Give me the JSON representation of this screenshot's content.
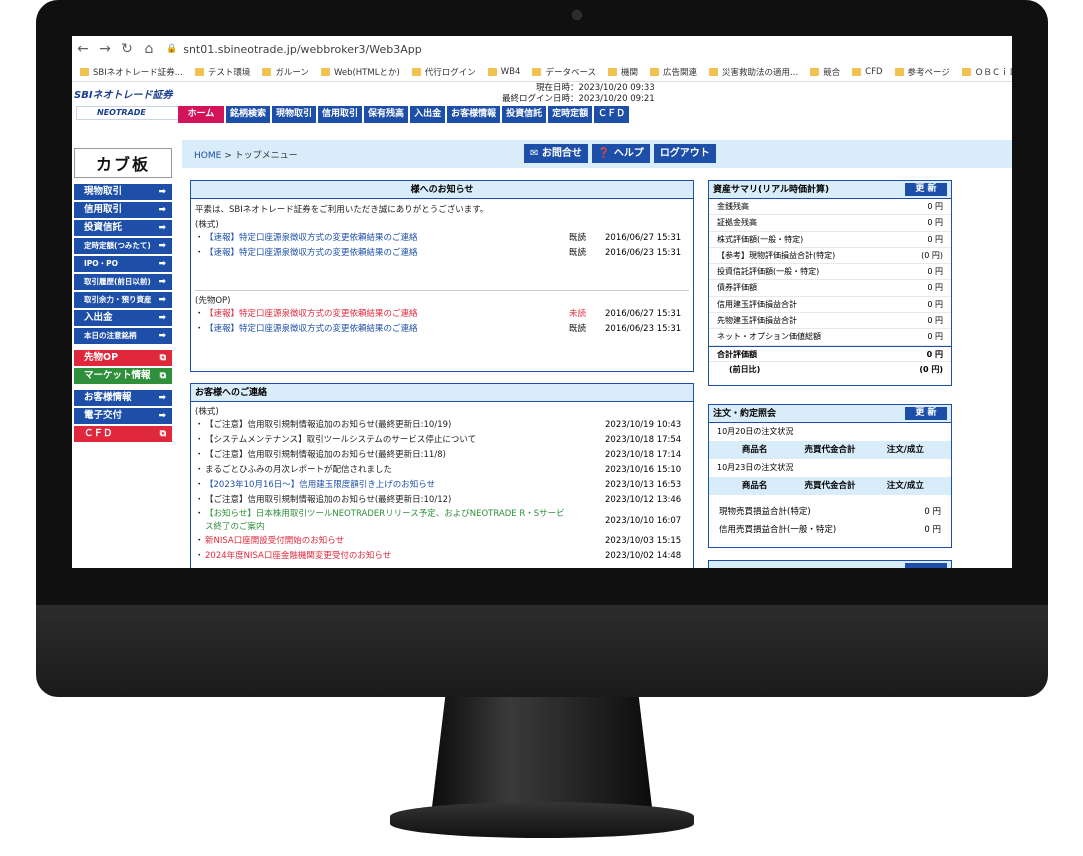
{
  "browser": {
    "url": "snt01.sbineotrade.jp/webbroker3/Web3App",
    "bookmarks": [
      "SBIネオトレード証券...",
      "テスト環境",
      "ガルーン",
      "Web(HTMLとか)",
      "代行ログイン",
      "WB4",
      "データベース",
      "機関",
      "広告関連",
      "災害救助法の適用...",
      "競合",
      "CFD",
      "参考ページ",
      "ＯＢＣｉＤ"
    ]
  },
  "header": {
    "sbi_logo": "SBIネオトレード証券",
    "neotrade_logo": "NEOTRADE",
    "current_time": "現在日時：2023/10/20 09:33",
    "last_login": "最終ログイン日時：2023/10/20 09:21"
  },
  "main_nav": [
    "ホーム",
    "銘柄検索",
    "現物取引",
    "信用取引",
    "保有残高",
    "入出金",
    "お客様情報",
    "投資信託",
    "定時定額",
    "ＣＦＤ"
  ],
  "sidebar": {
    "logo": "カブ板",
    "group1": [
      "現物取引",
      "信用取引",
      "投資信託",
      "定時定額(つみたて)",
      "IPO・PO",
      "取引履歴(前日以前)",
      "取引余力・預り資産",
      "入出金",
      "本日の注意銘柄"
    ],
    "futures_op": "先物OP",
    "market_info": "マーケット情報",
    "customer_info": "お客様情報",
    "e_delivery": "電子交付",
    "cfd": "ＣＦＤ"
  },
  "crumb": {
    "home": "HOME",
    "current": "> トップメニュー",
    "contact": "お問合せ",
    "help": "ヘルプ",
    "logout": "ログアウト"
  },
  "notice_panel": {
    "title": "様へのお知らせ",
    "greeting": "平素は、SBIネオトレード証券をご利用いただき誠にありがとうございます。",
    "stock_label": "(株式)",
    "stock_items": [
      {
        "title": "【速報】特定口座源泉徴収方式の変更依頼結果のご連絡",
        "status": "既読",
        "date": "2016/06/27 15:31",
        "color": "#1d4fa8"
      },
      {
        "title": "【速報】特定口座源泉徴収方式の変更依頼結果のご連絡",
        "status": "既読",
        "date": "2016/06/23 15:31",
        "color": "#1d4fa8"
      }
    ],
    "futures_label": "(先物OP)",
    "futures_items": [
      {
        "title": "【速報】特定口座源泉徴収方式の変更依頼結果のご連絡",
        "status": "未読",
        "date": "2016/06/27 15:31",
        "color": "#e0283c"
      },
      {
        "title": "【速報】特定口座源泉徴収方式の変更依頼結果のご連絡",
        "status": "既読",
        "date": "2016/06/23 15:31",
        "color": "#1d4fa8"
      }
    ]
  },
  "contact_panel": {
    "title": "お客様へのご連絡",
    "stock_label": "(株式)",
    "items": [
      {
        "title": "【ご注意】信用取引規制情報追加のお知らせ(最終更新日:10/19)",
        "date": "2023/10/19 10:43",
        "color": "#222222"
      },
      {
        "title": "【システムメンテナンス】取引ツールシステムのサービス停止について",
        "date": "2023/10/18 17:54",
        "color": "#222222"
      },
      {
        "title": "【ご注意】信用取引規制情報追加のお知らせ(最終更新日:11/8)",
        "date": "2023/10/18 17:14",
        "color": "#222222"
      },
      {
        "title": "まるごとひふみの月次レポートが配信されました",
        "date": "2023/10/16 15:10",
        "color": "#222222"
      },
      {
        "title": "【2023年10月16日～】信用建玉限度額引き上げのお知らせ",
        "date": "2023/10/13 16:53",
        "color": "#1d4fa8"
      },
      {
        "title": "【ご注意】信用取引規制情報追加のお知らせ(最終更新日:10/12)",
        "date": "2023/10/12 13:46",
        "color": "#222222"
      },
      {
        "title": "【お知らせ】日本株用取引ツールNEOTRADERリリース予定、およびNEOTRADE R・Sサービス終了のご案内",
        "date": "2023/10/10 16:07",
        "color": "#2f8f3a"
      },
      {
        "title": "新NISA口座開設受付開始のお知らせ",
        "date": "2023/10/03 15:15",
        "color": "#e0283c"
      },
      {
        "title": "2024年度NISA口座金融機関変更受付のお知らせ",
        "date": "2023/10/02 14:48",
        "color": "#e0283c"
      }
    ]
  },
  "asset_panel": {
    "title": "資産サマリ(リアル時価計算)",
    "refresh": "更 新",
    "rows": [
      {
        "label": "金銭残高",
        "value": "0 円"
      },
      {
        "label": "証拠金残高",
        "value": "0 円"
      },
      {
        "label": "株式評価額(一般・特定)",
        "value": "0 円"
      },
      {
        "label": "【参考】現物評価損益合計(特定)",
        "value": "(0 円)"
      },
      {
        "label": "投資信託評価額(一般・特定)",
        "value": "0 円"
      },
      {
        "label": "債券評価額",
        "value": "0 円"
      },
      {
        "label": "信用建玉評価損益合計",
        "value": "0 円"
      },
      {
        "label": "先物建玉評価損益合計",
        "value": "0 円"
      },
      {
        "label": "ネット・オプション価値総額",
        "value": "0 円"
      }
    ],
    "total_label": "合計評価額",
    "total_value": "0 円",
    "prev_label": "(前日比)",
    "prev_value": "(0 円)"
  },
  "order_panel": {
    "title": "注文・約定照会",
    "refresh": "更 新",
    "day1": "10月20日の注文状況",
    "day2": "10月23日の注文状況",
    "col_name": "商品名",
    "col_total": "売買代金合計",
    "col_status": "注文/成立",
    "sum1_label": "現物売買損益合計(特定)",
    "sum1_value": "0 円",
    "sum2_label": "信用売買損益合計(一般・特定)",
    "sum2_value": "0 円"
  }
}
